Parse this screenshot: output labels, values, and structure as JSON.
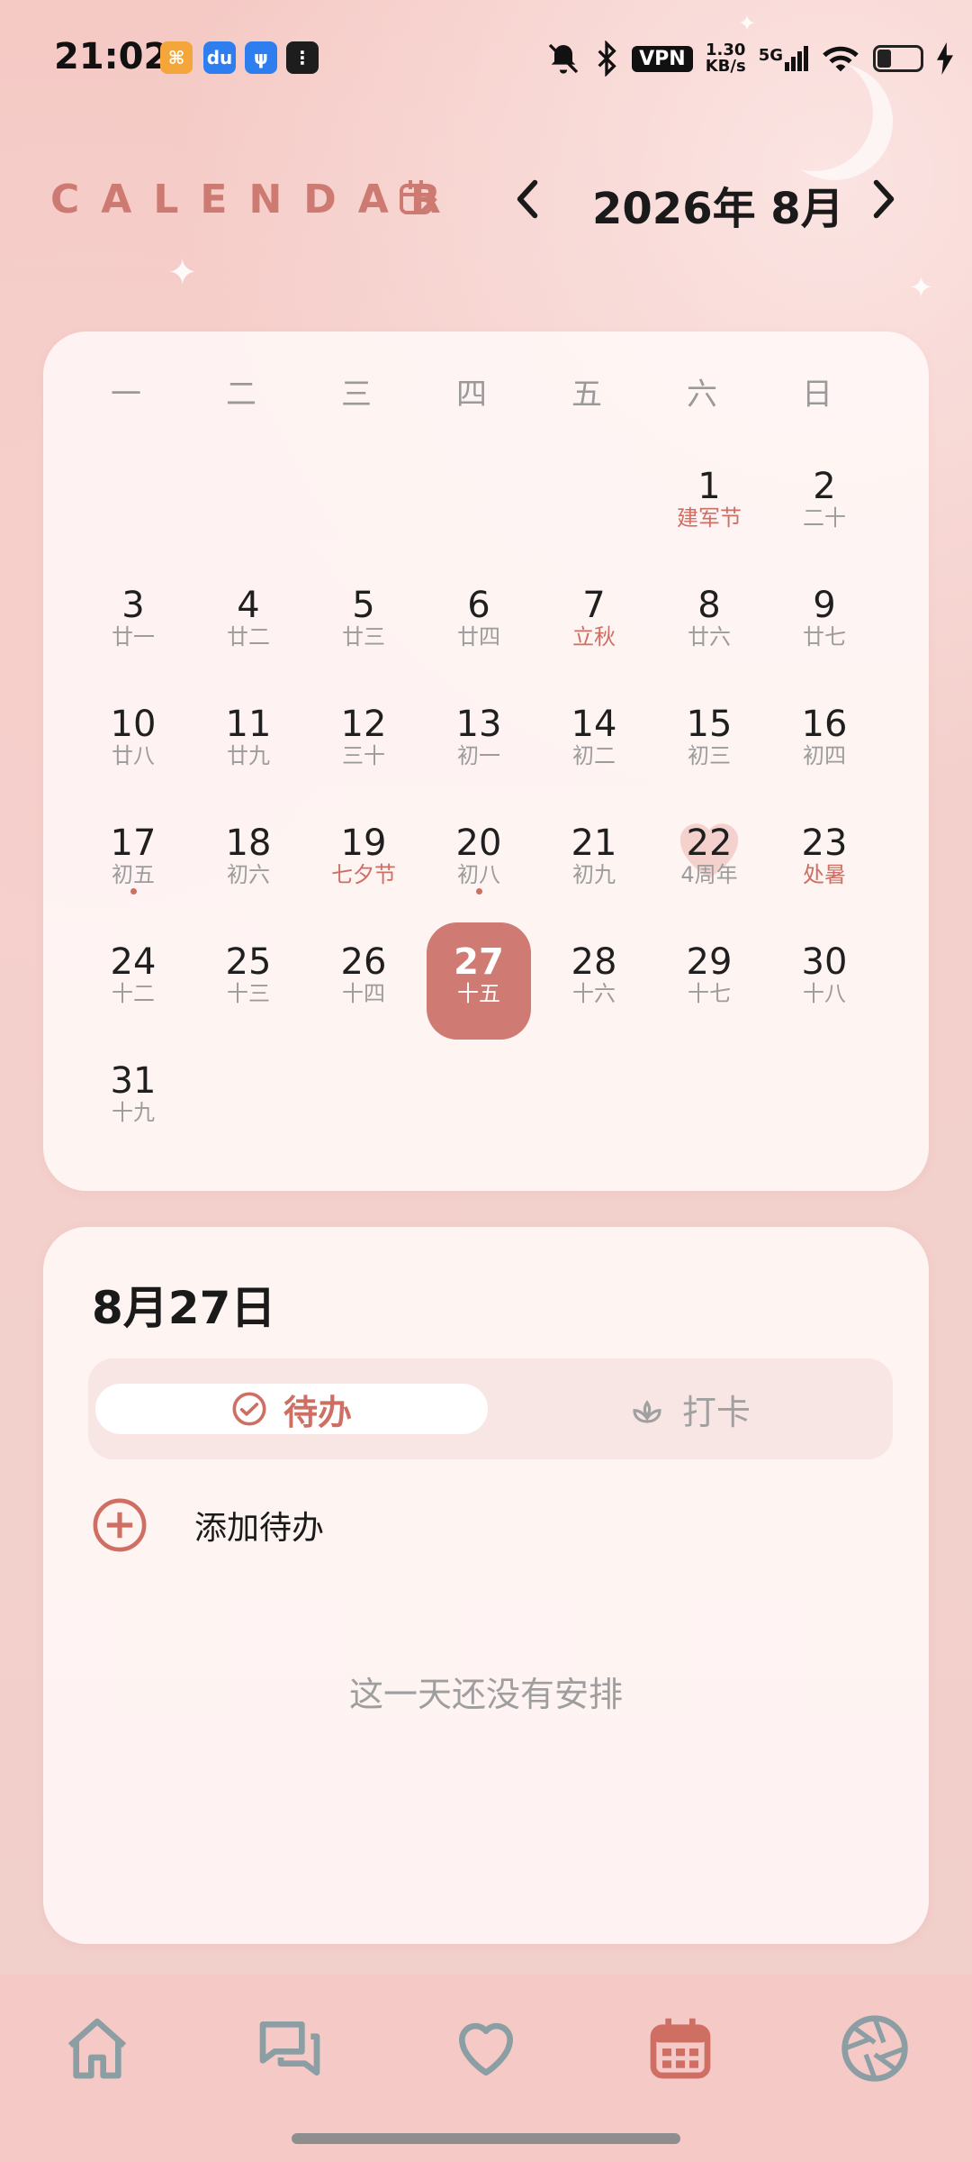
{
  "status_bar": {
    "time": "21:02",
    "vpn": "VPN",
    "speed_value": "1.30",
    "speed_unit": "KB/s",
    "network": "5G",
    "icons": [
      "app-notification-icon",
      "baidu-icon",
      "usb-icon",
      "grid-app-icon",
      "mute-bell-icon",
      "bluetooth-icon",
      "signal-icon",
      "wifi-icon",
      "battery-icon",
      "charging-icon"
    ]
  },
  "header": {
    "title": "CALENDAR",
    "month_label": "2026年 8月"
  },
  "calendar": {
    "weekdays": [
      "一",
      "二",
      "三",
      "四",
      "五",
      "六",
      "日"
    ],
    "days": [
      {
        "num": "1",
        "sub": "建军节",
        "red": true,
        "col": 5,
        "row": 0
      },
      {
        "num": "2",
        "sub": "二十",
        "col": 6,
        "row": 0
      },
      {
        "num": "3",
        "sub": "廿一",
        "col": 0,
        "row": 1
      },
      {
        "num": "4",
        "sub": "廿二",
        "col": 1,
        "row": 1
      },
      {
        "num": "5",
        "sub": "廿三",
        "col": 2,
        "row": 1
      },
      {
        "num": "6",
        "sub": "廿四",
        "col": 3,
        "row": 1
      },
      {
        "num": "7",
        "sub": "立秋",
        "red": true,
        "col": 4,
        "row": 1
      },
      {
        "num": "8",
        "sub": "廿六",
        "col": 5,
        "row": 1
      },
      {
        "num": "9",
        "sub": "廿七",
        "col": 6,
        "row": 1
      },
      {
        "num": "10",
        "sub": "廿八",
        "col": 0,
        "row": 2
      },
      {
        "num": "11",
        "sub": "廿九",
        "col": 1,
        "row": 2
      },
      {
        "num": "12",
        "sub": "三十",
        "col": 2,
        "row": 2
      },
      {
        "num": "13",
        "sub": "初一",
        "col": 3,
        "row": 2
      },
      {
        "num": "14",
        "sub": "初二",
        "col": 4,
        "row": 2
      },
      {
        "num": "15",
        "sub": "初三",
        "col": 5,
        "row": 2
      },
      {
        "num": "16",
        "sub": "初四",
        "col": 6,
        "row": 2
      },
      {
        "num": "17",
        "sub": "初五",
        "dot": true,
        "col": 0,
        "row": 3
      },
      {
        "num": "18",
        "sub": "初六",
        "col": 1,
        "row": 3
      },
      {
        "num": "19",
        "sub": "七夕节",
        "red": true,
        "col": 2,
        "row": 3
      },
      {
        "num": "20",
        "sub": "初八",
        "dot": true,
        "col": 3,
        "row": 3
      },
      {
        "num": "21",
        "sub": "初九",
        "col": 4,
        "row": 3
      },
      {
        "num": "22",
        "sub": "4周年",
        "heart": true,
        "col": 5,
        "row": 3
      },
      {
        "num": "23",
        "sub": "处暑",
        "red": true,
        "col": 6,
        "row": 3
      },
      {
        "num": "24",
        "sub": "十二",
        "col": 0,
        "row": 4
      },
      {
        "num": "25",
        "sub": "十三",
        "col": 1,
        "row": 4
      },
      {
        "num": "26",
        "sub": "十四",
        "col": 2,
        "row": 4
      },
      {
        "num": "27",
        "sub": "十五",
        "selected": true,
        "col": 3,
        "row": 4
      },
      {
        "num": "28",
        "sub": "十六",
        "col": 4,
        "row": 4
      },
      {
        "num": "29",
        "sub": "十七",
        "col": 5,
        "row": 4
      },
      {
        "num": "30",
        "sub": "十八",
        "col": 6,
        "row": 4
      },
      {
        "num": "31",
        "sub": "十九",
        "col": 0,
        "row": 5
      }
    ]
  },
  "todo": {
    "date_title": "8月27日",
    "tab_todo": "待办",
    "tab_checkin": "打卡",
    "add_label": "添加待办",
    "empty_text": "这一天还没有安排"
  },
  "tabbar": {
    "items": [
      "home-icon",
      "chat-icon",
      "heart-icon",
      "calendar-icon",
      "camera-aperture-icon"
    ],
    "active": "calendar-icon"
  },
  "colors": {
    "accent": "#cf7a72",
    "accent_text": "#cf6e63",
    "tab_inactive": "#8a9ea3"
  }
}
